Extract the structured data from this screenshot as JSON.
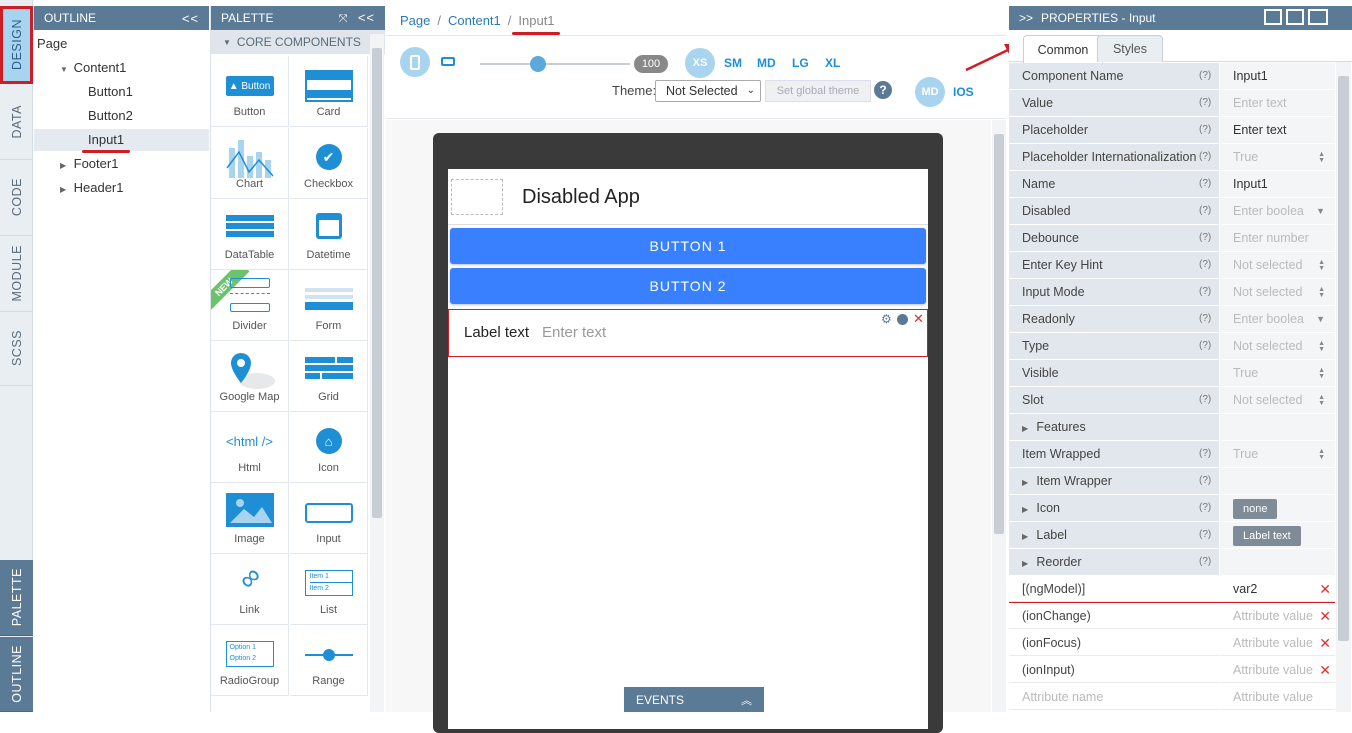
{
  "vertical_tabs": {
    "design": "DESIGN",
    "data": "DATA",
    "code": "CODE",
    "module": "MODULE",
    "scss": "SCSS",
    "palette": "PALETTE",
    "outline": "OUTLINE"
  },
  "outline": {
    "title": "OUTLINE",
    "collapse_icon": "double-chevron-left-icon",
    "tree": {
      "page": "Page",
      "content1": "Content1",
      "button1": "Button1",
      "button2": "Button2",
      "input1": "Input1",
      "footer1": "Footer1",
      "header1": "Header1"
    }
  },
  "palette": {
    "title": "PALETTE",
    "section": "CORE COMPONENTS",
    "new_badge": "NEW",
    "items": [
      "Button",
      "Card",
      "Chart",
      "Checkbox",
      "DataTable",
      "Datetime",
      "Divider",
      "Form",
      "Google Map",
      "Grid",
      "Html",
      "Icon",
      "Image",
      "Input",
      "Link",
      "List",
      "RadioGroup",
      "Range"
    ],
    "icon_texts": {
      "button": "Button",
      "html": "<html />",
      "list_1": "Item 1",
      "list_2": "Item 2",
      "radio_1": "Option 1",
      "radio_2": "Option 2"
    }
  },
  "breadcrumb": {
    "page": "Page",
    "content1": "Content1",
    "current": "Input1",
    "separator": "/"
  },
  "toolbar": {
    "zoom": "100",
    "breakpoints": [
      "XS",
      "SM",
      "MD",
      "LG",
      "XL"
    ],
    "theme_label": "Theme:",
    "theme_value": "Not Selected",
    "set_global_theme": "Set global theme",
    "mode_md": "MD",
    "mode_ios": "IOS"
  },
  "app_preview": {
    "title": "Disabled App",
    "button1": "BUTTON 1",
    "button2": "BUTTON 2",
    "input_label": "Label text",
    "input_placeholder": "Enter text"
  },
  "events_bar": "EVENTS",
  "properties": {
    "title": "PROPERTIES - Input",
    "tabs": {
      "common": "Common",
      "styles": "Styles"
    },
    "rows": [
      {
        "label": "Component Name",
        "help": "(?)",
        "value": "Input1",
        "filled": true
      },
      {
        "label": "Value",
        "help": "(?)",
        "value": "Enter text",
        "filled": false
      },
      {
        "label": "Placeholder",
        "help": "(?)",
        "value": "Enter text",
        "filled": true
      },
      {
        "label": "Placeholder Internationalization",
        "help": "(?)",
        "value": "True",
        "filled": false,
        "arrow": "updown"
      },
      {
        "label": "Name",
        "help": "(?)",
        "value": "Input1",
        "filled": true
      },
      {
        "label": "Disabled",
        "help": "(?)",
        "value": "Enter boolea",
        "filled": false,
        "arrow": "down"
      },
      {
        "label": "Debounce",
        "help": "(?)",
        "value": "Enter number",
        "filled": false
      },
      {
        "label": "Enter Key Hint",
        "help": "(?)",
        "value": "Not selected",
        "filled": false,
        "arrow": "updown"
      },
      {
        "label": "Input Mode",
        "help": "(?)",
        "value": "Not selected",
        "filled": false,
        "arrow": "updown"
      },
      {
        "label": "Readonly",
        "help": "(?)",
        "value": "Enter boolea",
        "filled": false,
        "arrow": "down"
      },
      {
        "label": "Type",
        "help": "(?)",
        "value": "Not selected",
        "filled": false,
        "arrow": "updown"
      },
      {
        "label": "Visible",
        "help": "",
        "value": "True",
        "filled": false,
        "arrow": "updown"
      },
      {
        "label": "Slot",
        "help": "(?)",
        "value": "Not selected",
        "filled": false,
        "arrow": "updown"
      },
      {
        "label": "Features",
        "help": "",
        "value": "",
        "filled": false,
        "expand": true
      },
      {
        "label": "Item Wrapped",
        "help": "(?)",
        "value": "True",
        "filled": false,
        "arrow": "updown"
      },
      {
        "label": "Item Wrapper",
        "help": "(?)",
        "value": "",
        "filled": false,
        "expand": true
      },
      {
        "label": "Icon",
        "help": "(?)",
        "value": "none",
        "chip": true,
        "expand": true
      },
      {
        "label": "Label",
        "help": "(?)",
        "value": "Label text",
        "chip": true,
        "expand": true
      },
      {
        "label": "Reorder",
        "help": "(?)",
        "value": "",
        "filled": false,
        "expand": true
      }
    ],
    "attributes": [
      {
        "name": "[(ngModel)]",
        "value": "var2",
        "filled": true,
        "highlight": true
      },
      {
        "name": "(ionChange)",
        "value": "Attribute value",
        "filled": false
      },
      {
        "name": "(ionFocus)",
        "value": "Attribute value",
        "filled": false
      },
      {
        "name": "(ionInput)",
        "value": "Attribute value",
        "filled": false
      },
      {
        "name": "Attribute name",
        "value": "Attribute value",
        "filled": false,
        "placeholder": true
      }
    ],
    "remove_glyph": "✕"
  },
  "colors": {
    "panel_header": "#5b7a96",
    "accent_blue": "#1e8fd5",
    "ionic_primary": "#3880ff",
    "highlight_red": "#d01c24"
  }
}
